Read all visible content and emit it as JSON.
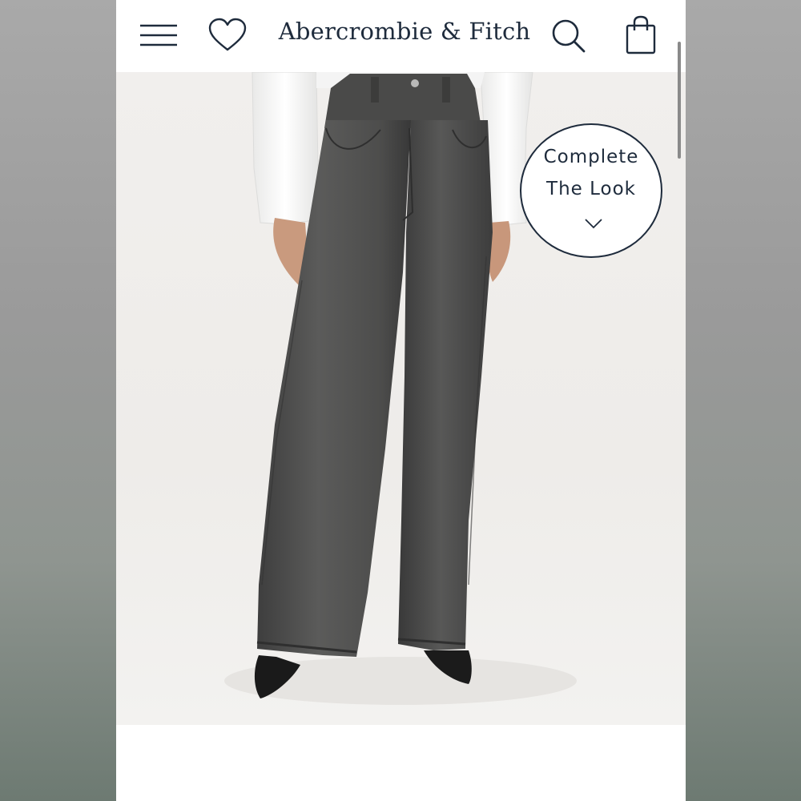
{
  "header": {
    "brand": "Abercrombie & Fitch",
    "icons": [
      "menu-icon",
      "heart-icon",
      "search-icon",
      "shopping-bag-icon"
    ]
  },
  "complete_the_look": {
    "label": "Complete\nThe Look",
    "icon": "chevron-down-icon"
  },
  "product_image": {
    "icon": "product-photo"
  },
  "colors": {
    "brand_navy": "#1e2b3c",
    "denim": "#4a4a4a",
    "background": "#f0eeeb"
  }
}
